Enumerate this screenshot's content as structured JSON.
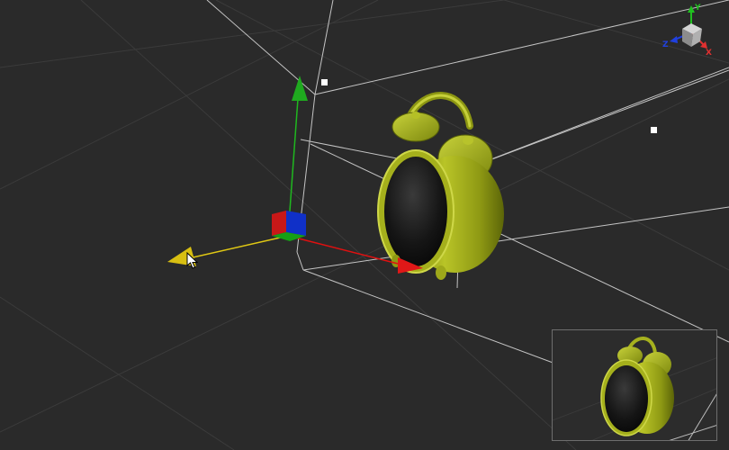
{
  "viewport": {
    "background_color": "#2a2a2a",
    "grid_color": "#3a3a3a",
    "bounding_box_color": "#bdbdbd"
  },
  "model": {
    "name_icon": "alarm-clock",
    "body_color": "#a8b418",
    "face_color": "#0f0f0f"
  },
  "gizmo": {
    "x_axis_color": "#e01010",
    "y_axis_color": "#1fb81f",
    "z_axis_color": "#e0c814",
    "center_color": "#1030c8"
  },
  "view_cube": {
    "labels": {
      "y": "Y",
      "x": "X",
      "z": "Z"
    },
    "colors": {
      "x": "#e03030",
      "y": "#20c020",
      "z": "#2040e0"
    }
  },
  "preview": {
    "border_color": "#6e6e6e"
  }
}
